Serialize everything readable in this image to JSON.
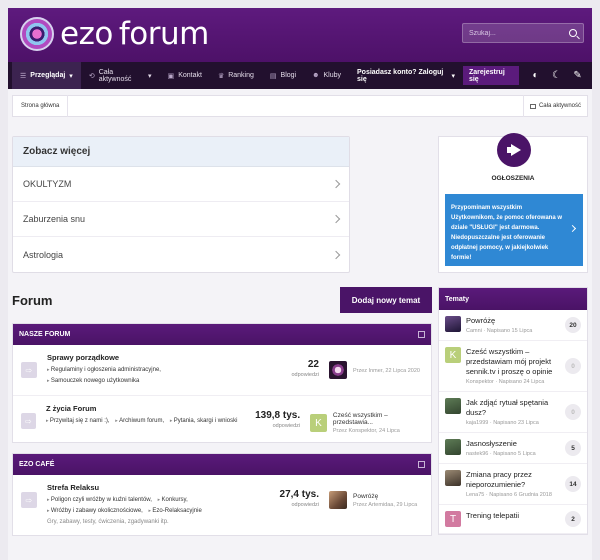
{
  "header": {
    "logo_text_a": "ezo",
    "logo_text_b": "forum",
    "search_placeholder": "Szukaj..."
  },
  "nav": {
    "items": [
      {
        "label": "Przeglądaj",
        "caret": "▾"
      },
      {
        "label": "Cała aktywność",
        "caret": "▾"
      },
      {
        "label": "Kontakt"
      },
      {
        "label": "Ranking"
      },
      {
        "label": "Blogi"
      },
      {
        "label": "Kluby"
      }
    ],
    "login": "Posiadasz konto? Zaloguj się",
    "login_caret": "▾",
    "register": "Zarejestruj się"
  },
  "breadcrumb": {
    "home": "Strona główna",
    "activity": "Cała aktywność"
  },
  "see_more": {
    "title": "Zobacz więcej",
    "items": [
      "OKULTYZM",
      "Zaburzenia snu",
      "Astrologia"
    ]
  },
  "forum": {
    "title": "Forum",
    "new_topic": "Dodaj nowy temat",
    "categories": [
      {
        "name": "NASZE FORUM",
        "nodes": [
          {
            "title": "Sprawy porządkowe",
            "subs": [
              "Regulaminy i ogłoszenia administracyjne,",
              "Samouczek nowego użytkownika"
            ],
            "count": "22",
            "count_label": "odpowiedzi",
            "last_title": "",
            "last_meta": "Przez Inmer, 22 Lipca 2020"
          },
          {
            "title": "Z życia Forum",
            "subs": [
              "Przywitaj się z nami :),",
              "Archiwum forum,",
              "Pytania, skargi i wnioski"
            ],
            "count": "139,8 tys.",
            "count_label": "odpowiedzi",
            "last_avatar": "K",
            "last_title": "Cześć wszystkim – przedstawia...",
            "last_meta": "Przez Konspektor, 24 Lipca"
          }
        ]
      },
      {
        "name": "EZO CAFÉ",
        "nodes": [
          {
            "title": "Strefa Relaksu",
            "subs": [
              "Poligon czyli wróżby w kuźni talentów,",
              "Konkursy,",
              "Wróżby i zabawy okolicznościowe,",
              "Ezo-Relaksacyjnie"
            ],
            "desc": "Gry, zabawy, testy, ćwiczenia, zgadywanki itp.",
            "count": "27,4 tys.",
            "count_label": "odpowiedzi",
            "last_title": "Powróżę",
            "last_meta": "Przez Artemidaa, 29 Lipca"
          }
        ]
      }
    ]
  },
  "announcement": {
    "title": "OGŁOSZENIA",
    "text": "Przypominam wszystkim Użytkownikom, że pomoc oferowana w dziale \"USŁUGI\" jest darmowa. Niedopuszczalne jest oferowanie odpłatnej pomocy, w jakiejkolwiek formie!"
  },
  "topics": {
    "title": "Tematy",
    "items": [
      {
        "title": "Powróżę",
        "meta": "Camni · Napisano 15 Lipca",
        "count": "20"
      },
      {
        "avatar": "K",
        "title": "Cześć wszystkim – przedstawiam mój projekt sennik.tv i proszę o opinie",
        "meta": "Konspektor · Napisano 24 Lipca",
        "count": "0"
      },
      {
        "title": "Jak zdjąć rytuał spętania dusz?",
        "meta": "kaja1999 · Napisano 23 Lipca",
        "count": "0"
      },
      {
        "title": "Jasnosłyszenie",
        "meta": "nastek96 · Napisano 5 Lipca",
        "count": "5"
      },
      {
        "title": "Zmiana pracy przez nieporozumienie?",
        "meta": "Lena75 · Napisano 6 Grudnia 2018",
        "count": "14"
      },
      {
        "avatar": "T",
        "title": "Trening telepatii",
        "meta": "",
        "count": "2"
      }
    ]
  },
  "colors": {
    "brand": "#4a1467",
    "nav_bg": "#22102e",
    "announce_blue": "#2f88d4"
  }
}
